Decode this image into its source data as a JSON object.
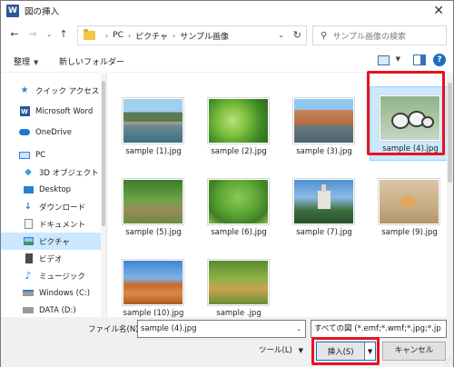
{
  "window": {
    "app_icon_letter": "W",
    "title": "図の挿入",
    "close_glyph": "✕"
  },
  "address_bar": {
    "breadcrumbs": [
      "PC",
      "ピクチャ",
      "サンプル画像"
    ],
    "search_placeholder": "サンプル画像の検索"
  },
  "toolbar": {
    "organize_label": "整理",
    "new_folder_label": "新しいフォルダー"
  },
  "nav": {
    "items": [
      {
        "label": "クイック アクセス",
        "icon": "star-icon"
      },
      {
        "label": "Microsoft Word",
        "icon": "word-icon"
      },
      {
        "label": "OneDrive",
        "icon": "cloud-icon"
      },
      {
        "label": "PC",
        "icon": "computer-icon"
      },
      {
        "label": "3D オブジェクト",
        "icon": "cube-icon"
      },
      {
        "label": "Desktop",
        "icon": "desktop-icon"
      },
      {
        "label": "ダウンロード",
        "icon": "download-icon"
      },
      {
        "label": "ドキュメント",
        "icon": "document-icon"
      },
      {
        "label": "ピクチャ",
        "icon": "pictures-icon",
        "selected": true
      },
      {
        "label": "ビデオ",
        "icon": "video-icon"
      },
      {
        "label": "ミュージック",
        "icon": "music-icon"
      },
      {
        "label": "Windows (C:)",
        "icon": "drive-icon"
      },
      {
        "label": "DATA (D:)",
        "icon": "drive-icon"
      }
    ]
  },
  "files": [
    {
      "name": "sample (1).jpg",
      "thumb": "canal"
    },
    {
      "name": "sample (2).jpg",
      "thumb": "leaf"
    },
    {
      "name": "sample (3).jpg",
      "thumb": "city"
    },
    {
      "name": "sample (4).jpg",
      "thumb": "ducklings",
      "selected": true
    },
    {
      "name": "sample (5).jpg",
      "thumb": "forest-path"
    },
    {
      "name": "sample (6).jpg",
      "thumb": "tree"
    },
    {
      "name": "sample (7).jpg",
      "thumb": "castle"
    },
    {
      "name": "sample (9).jpg",
      "thumb": "crab"
    },
    {
      "name": "sample (10).jpg",
      "thumb": "desert"
    },
    {
      "name": "sample .jpg",
      "thumb": "autumn-path"
    }
  ],
  "bottom": {
    "filename_label": "ファイル名(N):",
    "filename_value": "sample (4).jpg",
    "filetype_value": "すべての図 (*.emf;*.wmf;*.jpg;*.jp",
    "tools_label": "ツール(L)",
    "insert_label": "挿入(S)",
    "cancel_label": "キャンセル"
  },
  "colors": {
    "highlight_red": "#e8131d",
    "selection_blue": "#cce8ff",
    "accent_blue": "#0078d7"
  }
}
